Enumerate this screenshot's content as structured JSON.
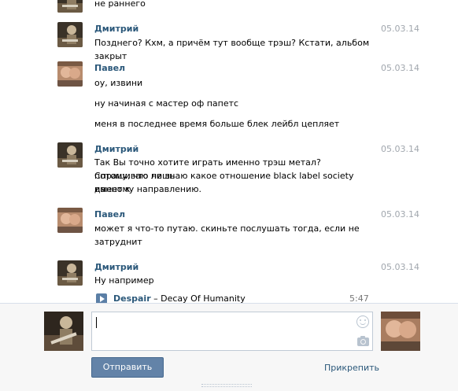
{
  "messages": [
    {
      "author": "",
      "date": "",
      "lines": [
        "не раннего"
      ],
      "avatar": "dmitry"
    },
    {
      "author": "Дмитрий",
      "date": "05.03.14",
      "lines": [
        "Позднего? Кхм, а причём тут вообще трэш? Кстати, альбом закрыт"
      ],
      "avatar": "dmitry"
    },
    {
      "author": "Павел",
      "date": "05.03.14",
      "lines": [
        "оу, извини",
        "ну начиная с мастер оф папетс",
        "меня в последнее время больше блек лейбл цепляет"
      ],
      "avatar": "pavel"
    },
    {
      "author": "Дмитрий",
      "date": "05.03.14",
      "lines": [
        "Так Вы точно хотите играть именно трэш метал? Спрашиваю лишь",
        "потому, что не знаю какое отношение black label society имеет к",
        "данному направлению."
      ],
      "avatar": "dmitry"
    },
    {
      "author": "Павел",
      "date": "05.03.14",
      "lines": [
        "может я что-то путаю. скиньте послушать тогда, если не",
        "затруднит"
      ],
      "avatar": "pavel"
    },
    {
      "author": "Дмитрий",
      "date": "05.03.14",
      "lines": [
        "Ну например"
      ],
      "avatar": "dmitry"
    }
  ],
  "audio": {
    "artist": "Despair",
    "separator": " – ",
    "title": "Decay Of Humanity",
    "duration": "5:47",
    "icon": "play-icon"
  },
  "composer": {
    "send_label": "Отправить",
    "attach_label": "Прикрепить",
    "message_value": "",
    "icons": [
      "smile-icon",
      "camera-icon"
    ]
  },
  "colors": {
    "author": "#2b587a",
    "date": "#a1a7ae",
    "send_button": "#6383a8",
    "composer_bg": "#f7f7f7"
  }
}
